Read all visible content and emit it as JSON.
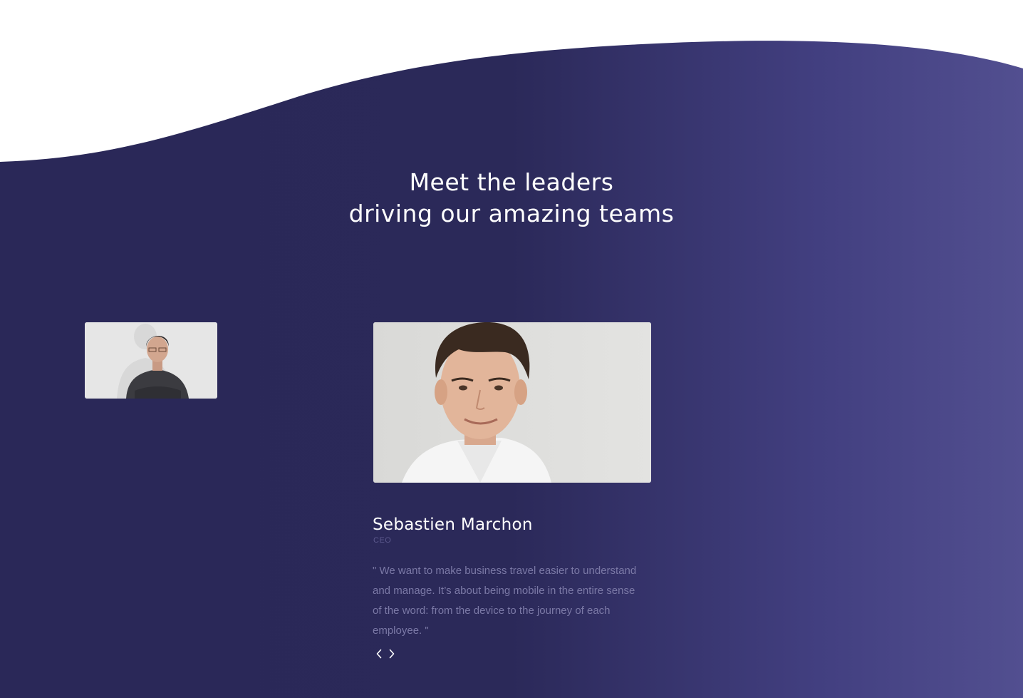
{
  "section": {
    "heading_line1": "Meet the leaders",
    "heading_line2": "driving our amazing teams"
  },
  "leader": {
    "name": "Sebastien Marchon",
    "role": "CEO",
    "quote": "\" We want to make business travel easier to understand and manage. It’s about being mobile in the entire sense of the word: from the device to the journey of each employee. \""
  },
  "carousel": {
    "prev_icon": "chevron-left-icon",
    "next_icon": "chevron-right-icon"
  },
  "colors": {
    "background_dark": "#2a2858",
    "background_light": "#524f90",
    "text_primary": "#ffffff",
    "text_muted": "#7b79a6",
    "role_text": "#5d5a8e"
  }
}
